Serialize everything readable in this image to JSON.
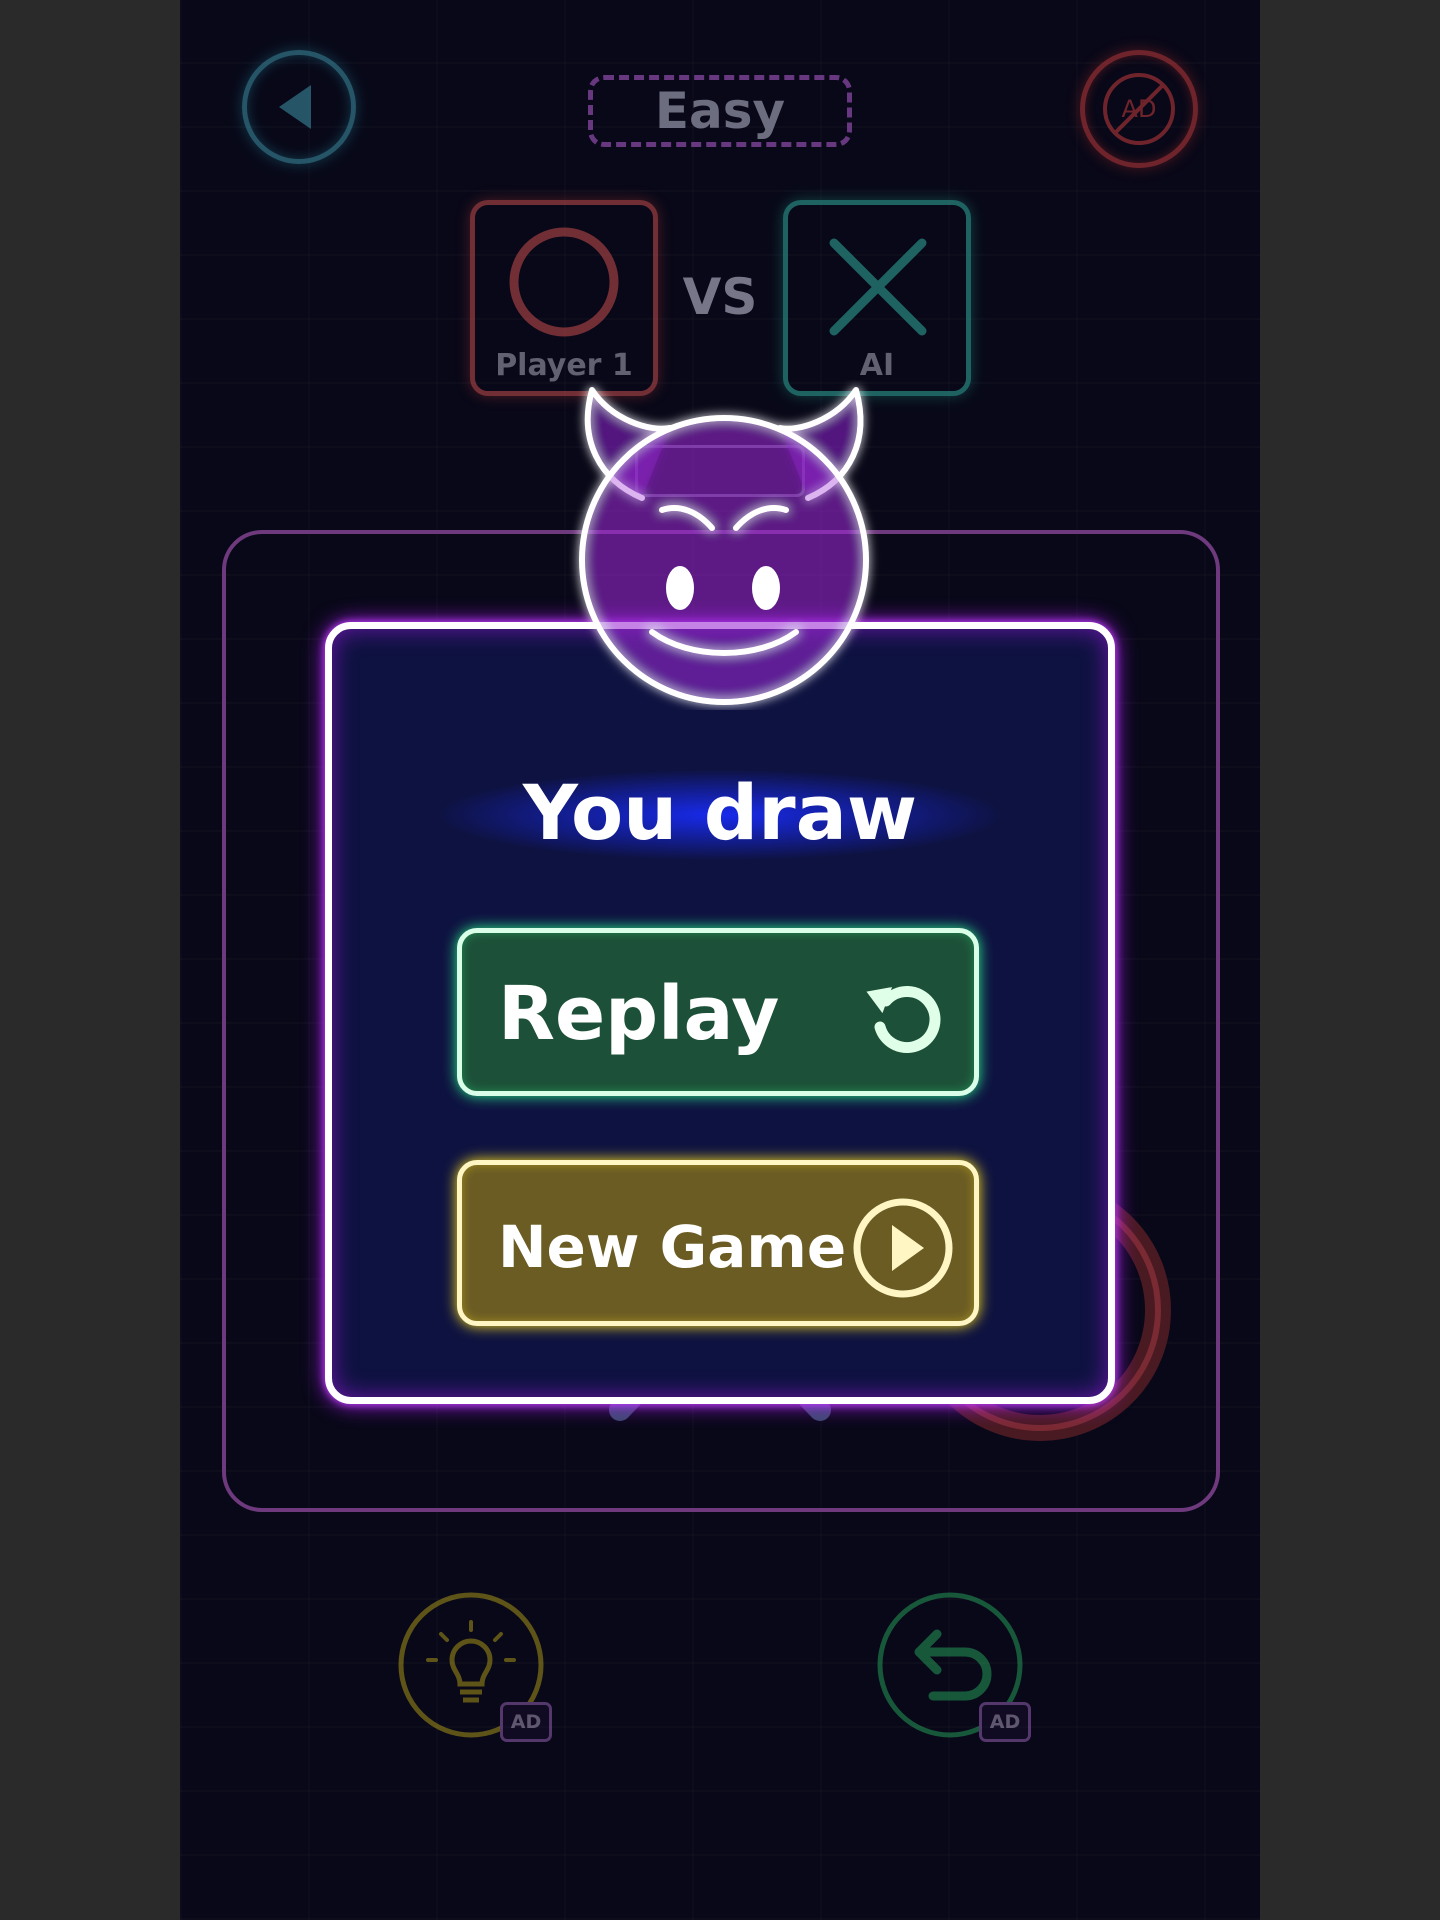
{
  "header": {
    "difficulty_label": "Easy",
    "back_icon": "back-arrow-icon",
    "no_ads_icon": "no-ads-icon",
    "no_ads_text": "AD"
  },
  "players": {
    "player1": {
      "label": "Player 1",
      "symbol": "O"
    },
    "vs_label": "VS",
    "opponent": {
      "label": "AI",
      "symbol": "X"
    }
  },
  "result": {
    "emoji": "devil-smiley-icon",
    "message": "You draw"
  },
  "buttons": {
    "replay_label": "Replay",
    "replay_icon": "restart-icon",
    "new_game_label": "New Game",
    "new_game_icon": "play-icon"
  },
  "bottom_bar": {
    "hint_icon": "lightbulb-icon",
    "undo_icon": "undo-icon",
    "ad_badge": "AD"
  },
  "colors": {
    "modal_border_glow": "#b41eff",
    "replay_bg": "#1d5038",
    "new_game_bg": "#6b5c24",
    "player1_color": "#b84848",
    "ai_color": "#2e9f92"
  }
}
